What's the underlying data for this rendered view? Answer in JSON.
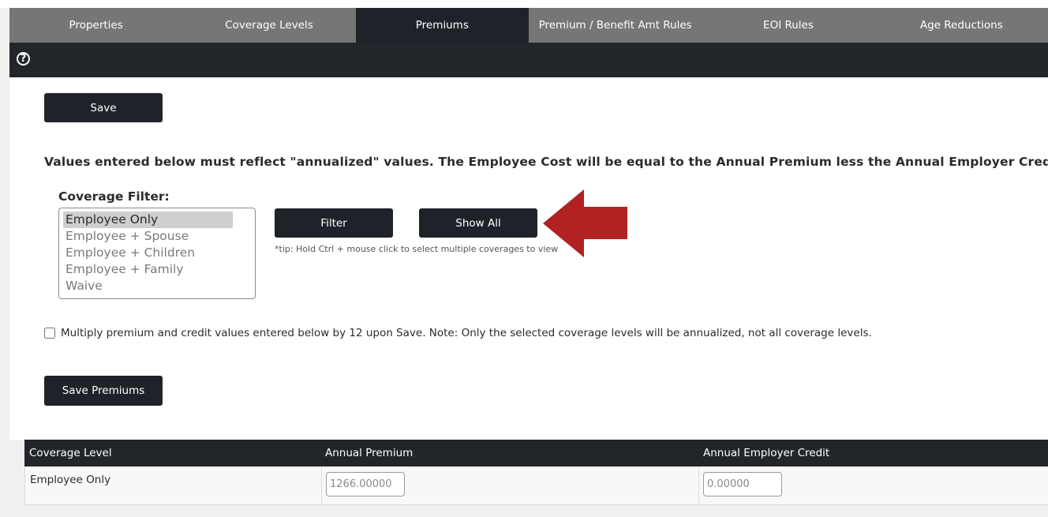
{
  "tabs": [
    {
      "label": "Properties",
      "active": false
    },
    {
      "label": "Coverage Levels",
      "active": false
    },
    {
      "label": "Premiums",
      "active": true
    },
    {
      "label": "Premium / Benefit Amt Rules",
      "active": false
    },
    {
      "label": "EOI Rules",
      "active": false
    },
    {
      "label": "Age Reductions",
      "active": false
    }
  ],
  "toolbar": {
    "help_icon": "question-circle-icon",
    "help_glyph": "?"
  },
  "form": {
    "save_label": "Save",
    "notice": "Values entered below must reflect \"annualized\" values. The Employee Cost will be equal to the Annual Premium less the Annual Employer Credit.",
    "filter_label": "Coverage Filter:",
    "coverage_options": [
      "Employee Only",
      "Employee + Spouse",
      "Employee + Children",
      "Employee + Family",
      "Waive"
    ],
    "selected_option": "Employee Only",
    "filter_button": "Filter",
    "show_all_button": "Show All",
    "tip": "*tip: Hold Ctrl + mouse click to select multiple coverages to view",
    "multiply_checked": false,
    "multiply_label": "Multiply premium and credit values entered below by 12 upon Save. Note: Only the selected coverage levels will be annualized, not all coverage levels.",
    "save_premiums_label": "Save Premiums"
  },
  "annotation": {
    "arrow_color": "#b22222",
    "arrow_icon": "left-arrow-icon"
  },
  "grid": {
    "headers": {
      "coverage_level": "Coverage Level",
      "annual_premium": "Annual Premium",
      "employer_credit": "Annual Employer Credit"
    },
    "rows": [
      {
        "coverage_level": "Employee Only",
        "annual_premium": "1266.00000",
        "employer_credit": "0.00000"
      }
    ]
  },
  "colors": {
    "dark": "#1f2329",
    "tab_gray": "#767676",
    "accent_red": "#b22222"
  }
}
